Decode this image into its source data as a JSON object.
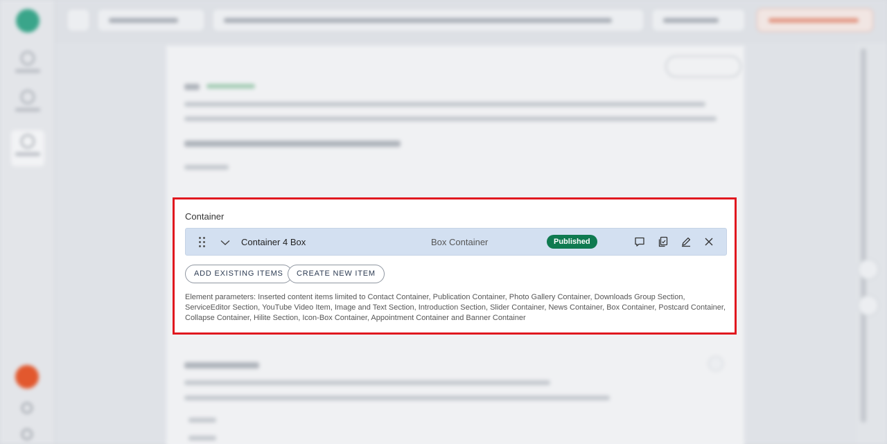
{
  "container": {
    "title": "Container",
    "item": {
      "name": "Container 4 Box",
      "type": "Box Container",
      "status": "Published"
    },
    "actions": {
      "add_existing": "ADD EXISTING ITEMS",
      "create_new": "CREATE NEW ITEM"
    },
    "parameters": "Element parameters: Inserted content items limited to Contact Container, Publication Container, Photo Gallery Container, Downloads Group Section, ServiceEditor Section, YouTube Video Item, Image and Text Section, Introduction Section, Slider Container, News Container, Box Container, Postcard Container, Collapse Container, Hilite Section, Icon-Box Container, Appointment Container and Banner Container"
  },
  "colors": {
    "highlight_border": "#e0181f",
    "row_background": "#d3e0f1",
    "published_badge": "#0f7a50"
  },
  "icons": [
    "drag-handle-icon",
    "chevron-down-icon",
    "comment-icon",
    "copy-icon",
    "edit-icon",
    "close-icon"
  ]
}
